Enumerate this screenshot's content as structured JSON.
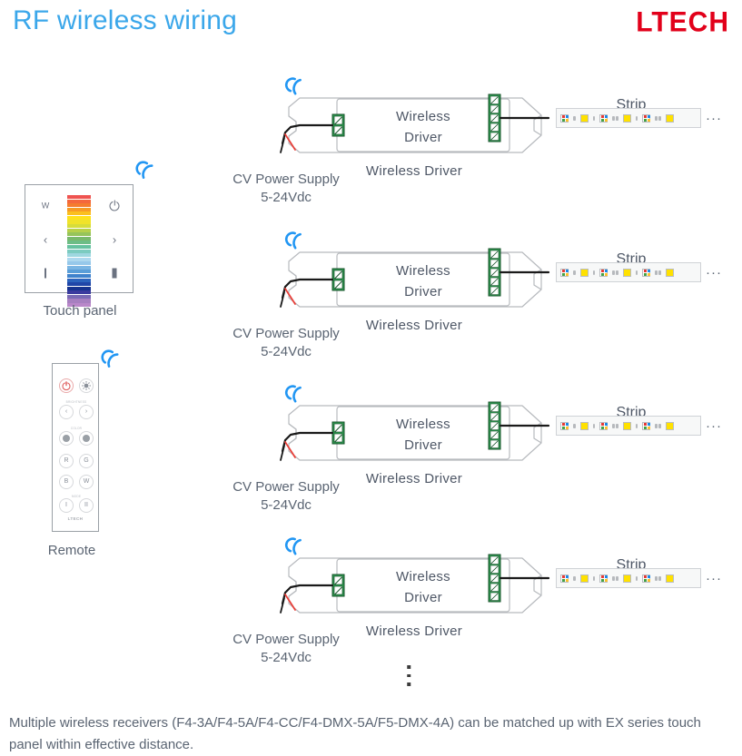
{
  "header": {
    "title": "RF wireless wiring",
    "brand": "LTECH",
    "title_color": "#3ba7ea",
    "brand_color": "#e2001a"
  },
  "touch_panel": {
    "caption": "Touch panel",
    "keys": {
      "top_left": "W",
      "top_right": "power-icon",
      "mid_left": "‹",
      "mid_right": "›",
      "bottom_left": "thin-bar-icon",
      "bottom_right": "thick-bar-icon"
    },
    "gradient_colors": [
      "#ef5350",
      "#f4673c",
      "#f57c2e",
      "#f79a24",
      "#fbbf1e",
      "#ffe11c",
      "#f0e32a",
      "#d6dd3a",
      "#b6d04b",
      "#96c45b",
      "#78b96c",
      "#6dbd86",
      "#66c2a0",
      "#7ccbc0",
      "#9ed7e0",
      "#add8ef",
      "#96c8ea",
      "#7ab5e3",
      "#5a9ed8",
      "#3f82cc",
      "#2b63bd",
      "#1f46a8",
      "#16338f",
      "#3b3b9e",
      "#7b6bb5",
      "#a77fc0",
      "#b987c9"
    ],
    "rf_icon": "rf-signal-icon"
  },
  "remote": {
    "caption": "Remote",
    "logo": "LTECH",
    "rf_icon": "rf-signal-icon",
    "buttons": [
      {
        "left": "power-icon",
        "right": "brightness-icon",
        "group_label": ""
      },
      {
        "left": "‹",
        "right": "›",
        "group_label": "BRIGHTNESS"
      },
      {
        "left": "dot-icon",
        "right": "dot-icon",
        "group_label": "COLOR"
      },
      {
        "left": "R",
        "right": "G",
        "group_label": ""
      },
      {
        "left": "B",
        "right": "W",
        "group_label": ""
      },
      {
        "left": "I",
        "right": "II",
        "group_label": "MODE"
      }
    ]
  },
  "rows": [
    {
      "rf_icon": "rf-signal-icon",
      "device_title_line1": "Wireless",
      "device_title_line2": "Driver",
      "device_caption": "Wireless Driver",
      "power_label_line1": "CV Power Supply",
      "power_label_line2": "5-24Vdc",
      "strip_label": "Strip",
      "strip_ellipsis": "···"
    },
    {
      "rf_icon": "rf-signal-icon",
      "device_title_line1": "Wireless",
      "device_title_line2": "Driver",
      "device_caption": "Wireless Driver",
      "power_label_line1": "CV Power Supply",
      "power_label_line2": "5-24Vdc",
      "strip_label": "Strip",
      "strip_ellipsis": "···"
    },
    {
      "rf_icon": "rf-signal-icon",
      "device_title_line1": "Wireless",
      "device_title_line2": "Driver",
      "device_caption": "Wireless Driver",
      "power_label_line1": "CV Power Supply",
      "power_label_line2": "5-24Vdc",
      "strip_label": "Strip",
      "strip_ellipsis": "···"
    },
    {
      "rf_icon": "rf-signal-icon",
      "device_title_line1": "Wireless",
      "device_title_line2": "Driver",
      "device_caption": "Wireless Driver",
      "power_label_line1": "CV Power Supply",
      "power_label_line2": "5-24Vdc",
      "strip_label": "Strip",
      "strip_ellipsis": "···"
    }
  ],
  "continuation": "vertical-ellipsis",
  "footer": {
    "note": "Multiple wireless receivers (F4-3A/F4-5A/F4-CC/F4-DMX-5A/F5-DMX-4A) can be matched up with EX series touch panel within effective distance."
  },
  "colors": {
    "accent_blue": "#3ba7ea",
    "brand_red": "#e2001a",
    "text_gray": "#5a6472",
    "terminal_green": "#2f9e52",
    "wire_black": "#1a1a1a",
    "wire_red": "#e8403a",
    "led_yellow": "#ffe100"
  }
}
